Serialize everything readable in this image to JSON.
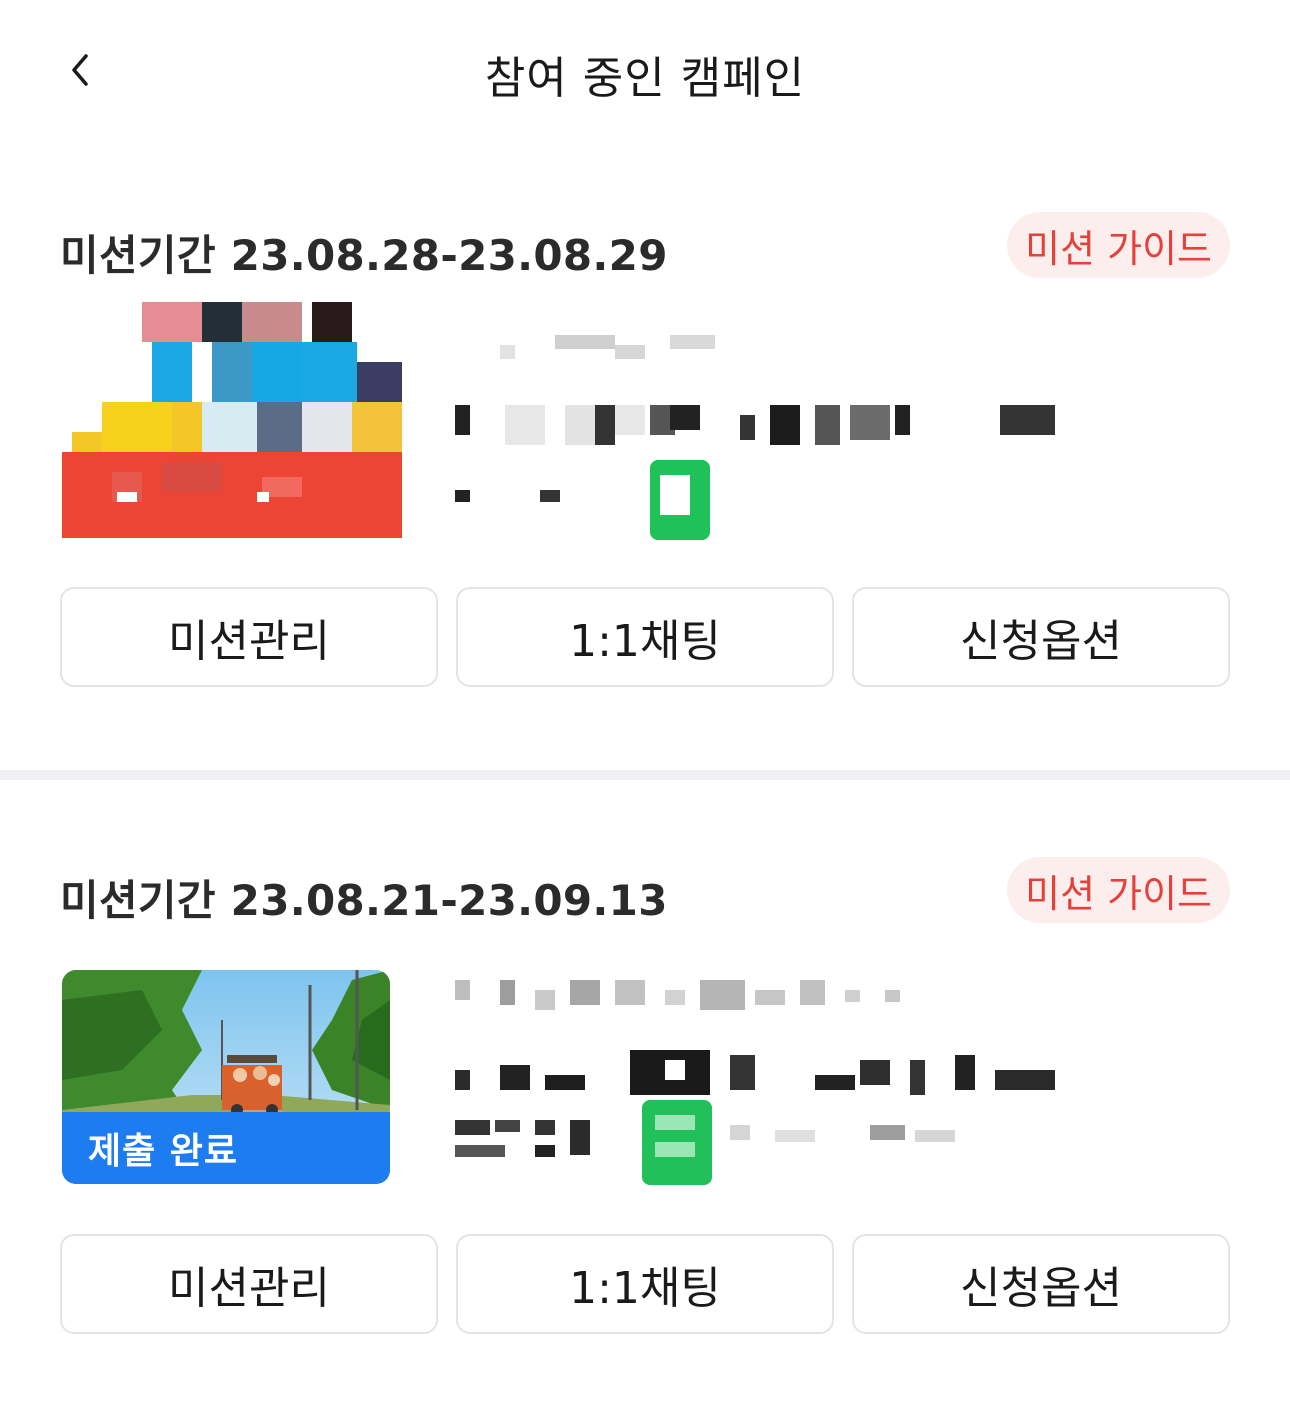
{
  "header": {
    "back_icon": "chevron-left-icon",
    "title": "참여 중인 캠페인"
  },
  "campaigns": [
    {
      "period": "미션기간 23.08.28-23.08.29",
      "guide_label": "미션 가이드",
      "status_badge": "",
      "info_redacted": true,
      "actions": [
        "미션관리",
        "1:1채팅",
        "신청옵션"
      ]
    },
    {
      "period": "미션기간 23.08.21-23.09.13",
      "guide_label": "미션 가이드",
      "status_badge": "제출 완료",
      "info_redacted": true,
      "actions": [
        "미션관리",
        "1:1채팅",
        "신청옵션"
      ]
    }
  ],
  "colors": {
    "accent_red": "#e5413b",
    "guide_bg": "#fdeeee",
    "badge_blue": "#1e7cf1",
    "divider": "#eff0f3",
    "button_border": "#e3e4e8"
  }
}
